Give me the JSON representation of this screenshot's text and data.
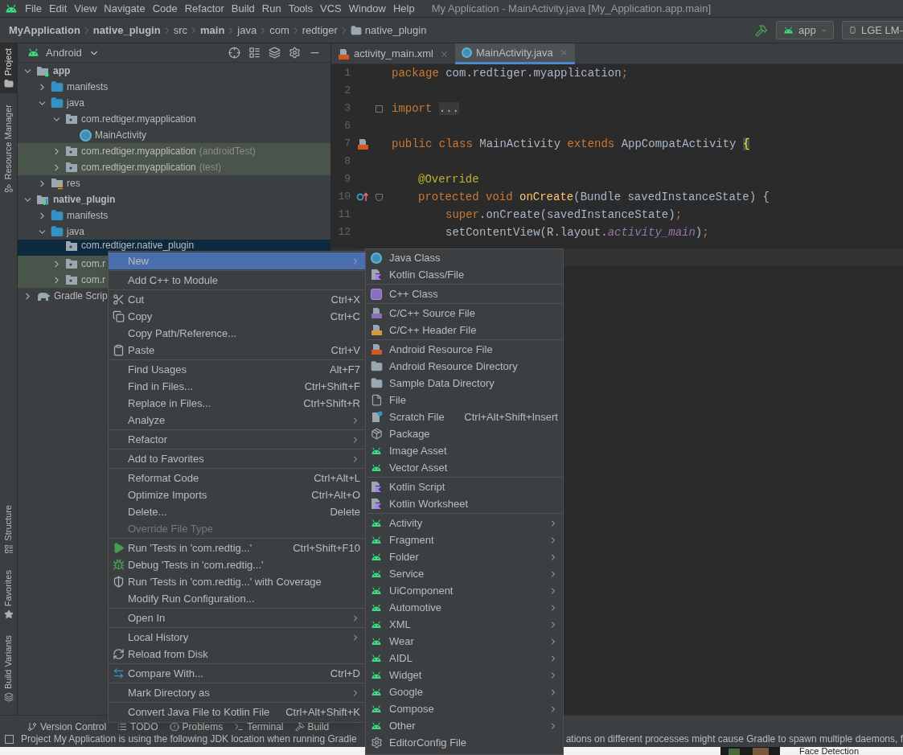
{
  "menu_bar": {
    "items": [
      "File",
      "Edit",
      "View",
      "Navigate",
      "Code",
      "Refactor",
      "Build",
      "Run",
      "Tools",
      "VCS",
      "Window",
      "Help"
    ],
    "title": "My Application - MainActivity.java [My_Application.app.main]"
  },
  "breadcrumbs": [
    {
      "label": "MyApplication",
      "bold": true,
      "folder": false
    },
    {
      "label": "native_plugin",
      "bold": true,
      "folder": false
    },
    {
      "label": "src",
      "bold": false,
      "folder": false
    },
    {
      "label": "main",
      "bold": true,
      "folder": false
    },
    {
      "label": "java",
      "bold": false,
      "folder": false
    },
    {
      "label": "com",
      "bold": false,
      "folder": false
    },
    {
      "label": "redtiger",
      "bold": false,
      "folder": false
    },
    {
      "label": "native_plugin",
      "bold": false,
      "folder": true
    }
  ],
  "run_config": {
    "label": "app"
  },
  "device": {
    "label": "LGE LM-"
  },
  "tool_strip": {
    "top": [
      {
        "label": "Project",
        "selected": true,
        "kind": "folder"
      },
      {
        "label": "Resource Manager",
        "selected": false,
        "kind": "shapes"
      }
    ],
    "bottom": [
      {
        "label": "Structure",
        "kind": "structure"
      },
      {
        "label": "Favorites",
        "kind": "star"
      },
      {
        "label": "Build Variants",
        "kind": "variants"
      }
    ]
  },
  "project_panel": {
    "view": "Android",
    "tree": [
      {
        "label": "app",
        "kind": "module",
        "expanded": true,
        "selected": false,
        "children": [
          {
            "label": "manifests",
            "kind": "folder",
            "expanded": false,
            "selected": false
          },
          {
            "label": "java",
            "kind": "folder",
            "expanded": true,
            "selected": false,
            "children": [
              {
                "label": "com.redtiger.myapplication",
                "kind": "package",
                "expanded": true,
                "selected": false,
                "children": [
                  {
                    "label": "MainActivity",
                    "kind": "class",
                    "selected": false
                  }
                ]
              },
              {
                "label": "com.redtiger.myapplication",
                "suffix": "(androidTest)",
                "kind": "test_package",
                "expanded": false,
                "selected": false
              },
              {
                "label": "com.redtiger.myapplication",
                "suffix": "(test)",
                "kind": "test_package",
                "expanded": false,
                "selected": false
              }
            ]
          },
          {
            "label": "res",
            "kind": "res",
            "expanded": false,
            "selected": false
          }
        ]
      },
      {
        "label": "native_plugin",
        "kind": "native_module",
        "expanded": true,
        "selected": false,
        "children": [
          {
            "label": "manifests",
            "kind": "folder",
            "expanded": false,
            "selected": false
          },
          {
            "label": "java",
            "kind": "folder",
            "expanded": true,
            "selected": false,
            "children": [
              {
                "label": "com.redtiger.native_plugin",
                "kind": "package",
                "selected": true
              },
              {
                "label": "com.r",
                "kind": "test_package",
                "expanded": false,
                "selected": false
              },
              {
                "label": "com.r",
                "kind": "test_package",
                "expanded": false,
                "selected": false
              }
            ]
          }
        ]
      },
      {
        "label": "Gradle Scrip",
        "kind": "gradle",
        "expanded": false,
        "selected": false
      }
    ]
  },
  "editor": {
    "tabs": [
      {
        "label": "activity_main.xml",
        "kind": "xml",
        "selected": false
      },
      {
        "label": "MainActivity.java",
        "kind": "java",
        "selected": true
      }
    ],
    "lines": [
      {
        "number": "1",
        "kind": "top",
        "tokens": [
          {
            "text": "package",
            "kind": "keyword"
          },
          {
            "text": " com.redtiger.myapplication",
            "kind": "plain"
          },
          {
            "text": ";",
            "kind": "keyword"
          }
        ]
      },
      {
        "number": "2",
        "kind": "top"
      },
      {
        "number": "3",
        "kind": "import",
        "tokens": [
          {
            "text": "import",
            "kind": "keyword"
          },
          {
            "text": "...",
            "kind": "folded"
          }
        ]
      },
      {
        "number": "6",
        "kind": "top"
      },
      {
        "number": "7",
        "kind": "class",
        "tokens": [
          {
            "text": "public class",
            "kind": "keyword"
          },
          {
            "text": " MainActivity ",
            "kind": "plain"
          },
          {
            "text": "extends",
            "kind": "keyword"
          },
          {
            "text": " AppCompatActivity ",
            "kind": "plain"
          },
          {
            "text": "{",
            "kind": "brace"
          }
        ]
      },
      {
        "number": "8",
        "kind": "top"
      },
      {
        "number": "9",
        "kind": "annotation",
        "tokens": [
          {
            "text": "@Override",
            "kind": "annotation"
          }
        ]
      },
      {
        "number": "10",
        "kind": "method",
        "tokens": [
          {
            "text": "protected void",
            "kind": "keyword"
          },
          {
            "text": "onCreate",
            "kind": "method"
          },
          {
            "text": "(Bundle savedInstanceState) {",
            "kind": "plain"
          }
        ]
      },
      {
        "number": "11",
        "kind": "statement",
        "tokens": [
          {
            "text": "super",
            "kind": "keyword"
          },
          {
            "text": ".onCreate(savedInstanceState)",
            "kind": "plain"
          },
          {
            "text": ";",
            "kind": "keyword"
          }
        ]
      },
      {
        "number": "12",
        "kind": "statement",
        "tokens": [
          {
            "text": "setContentView(R.layout.",
            "kind": "plain"
          },
          {
            "text": "activity_main",
            "kind": "field"
          },
          {
            "text": ")",
            "kind": "plain"
          },
          {
            "text": ";",
            "kind": "keyword"
          }
        ]
      }
    ]
  },
  "context_menu": {
    "items": [
      {
        "kind": "plain",
        "label": "New",
        "submenu": true,
        "highlighted": true,
        "disabled": false
      },
      {
        "kind": "separator"
      },
      {
        "kind": "plain",
        "label": "Add C++ to Module",
        "submenu": false,
        "highlighted": false,
        "disabled": false
      },
      {
        "kind": "separator"
      },
      {
        "kind": "cut",
        "label": "Cut",
        "shortcut": "Ctrl+X",
        "submenu": false,
        "highlighted": false,
        "disabled": false
      },
      {
        "kind": "copy",
        "label": "Copy",
        "shortcut": "Ctrl+C",
        "submenu": false,
        "highlighted": false,
        "disabled": false
      },
      {
        "kind": "plain",
        "label": "Copy Path/Reference...",
        "submenu": false,
        "highlighted": false,
        "disabled": false
      },
      {
        "kind": "paste",
        "label": "Paste",
        "shortcut": "Ctrl+V",
        "submenu": false,
        "highlighted": false,
        "disabled": false
      },
      {
        "kind": "separator"
      },
      {
        "kind": "plain",
        "label": "Find Usages",
        "shortcut": "Alt+F7",
        "submenu": false,
        "highlighted": false,
        "disabled": false
      },
      {
        "kind": "plain",
        "label": "Find in Files...",
        "shortcut": "Ctrl+Shift+F",
        "submenu": false,
        "highlighted": false,
        "disabled": false
      },
      {
        "kind": "plain",
        "label": "Replace in Files...",
        "shortcut": "Ctrl+Shift+R",
        "submenu": false,
        "highlighted": false,
        "disabled": false
      },
      {
        "kind": "plain",
        "label": "Analyze",
        "submenu": true,
        "highlighted": false,
        "disabled": false
      },
      {
        "kind": "separator"
      },
      {
        "kind": "plain",
        "label": "Refactor",
        "submenu": true,
        "highlighted": false,
        "disabled": false
      },
      {
        "kind": "separator"
      },
      {
        "kind": "plain",
        "label": "Add to Favorites",
        "submenu": true,
        "highlighted": false,
        "disabled": false
      },
      {
        "kind": "separator"
      },
      {
        "kind": "plain",
        "label": "Reformat Code",
        "shortcut": "Ctrl+Alt+L",
        "submenu": false,
        "highlighted": false,
        "disabled": false
      },
      {
        "kind": "plain",
        "label": "Optimize Imports",
        "shortcut": "Ctrl+Alt+O",
        "submenu": false,
        "highlighted": false,
        "disabled": false
      },
      {
        "kind": "plain",
        "label": "Delete...",
        "shortcut": "Delete",
        "submenu": false,
        "highlighted": false,
        "disabled": false
      },
      {
        "kind": "plain",
        "label": "Override File Type",
        "submenu": false,
        "highlighted": false,
        "disabled": true
      },
      {
        "kind": "separator"
      },
      {
        "kind": "run",
        "label": "Run 'Tests in 'com.redtig...'",
        "shortcut": "Ctrl+Shift+F10",
        "submenu": false,
        "highlighted": false,
        "disabled": false
      },
      {
        "kind": "debug",
        "label": "Debug 'Tests in 'com.redtig...'",
        "submenu": false,
        "highlighted": false,
        "disabled": false
      },
      {
        "kind": "coverage",
        "label": "Run 'Tests in 'com.redtig...' with Coverage",
        "submenu": false,
        "highlighted": false,
        "disabled": false
      },
      {
        "kind": "plain",
        "label": "Modify Run Configuration...",
        "submenu": false,
        "highlighted": false,
        "disabled": false
      },
      {
        "kind": "separator"
      },
      {
        "kind": "plain",
        "label": "Open In",
        "submenu": true,
        "highlighted": false,
        "disabled": false
      },
      {
        "kind": "separator"
      },
      {
        "kind": "plain",
        "label": "Local History",
        "submenu": true,
        "highlighted": false,
        "disabled": false
      },
      {
        "kind": "reload",
        "label": "Reload from Disk",
        "submenu": false,
        "highlighted": false,
        "disabled": false
      },
      {
        "kind": "separator"
      },
      {
        "kind": "compare",
        "label": "Compare With...",
        "shortcut": "Ctrl+D",
        "submenu": false,
        "highlighted": false,
        "disabled": false
      },
      {
        "kind": "separator"
      },
      {
        "kind": "plain",
        "label": "Mark Directory as",
        "submenu": true,
        "highlighted": false,
        "disabled": false
      },
      {
        "kind": "separator"
      },
      {
        "kind": "plain",
        "label": "Convert Java File to Kotlin File",
        "shortcut": "Ctrl+Alt+Shift+K",
        "submenu": false,
        "highlighted": false,
        "disabled": false
      }
    ]
  },
  "new_submenu": {
    "items": [
      {
        "kind": "java_class",
        "label": "Java Class",
        "submenu": false
      },
      {
        "kind": "kotlin_file",
        "label": "Kotlin Class/File",
        "submenu": false
      },
      {
        "kind": "separator"
      },
      {
        "kind": "cpp_class",
        "label": "C++ Class",
        "submenu": false
      },
      {
        "kind": "separator"
      },
      {
        "kind": "cpp_source",
        "label": "C/C++ Source File",
        "submenu": false
      },
      {
        "kind": "cpp_header",
        "label": "C/C++ Header File",
        "submenu": false
      },
      {
        "kind": "separator"
      },
      {
        "kind": "resource_file",
        "label": "Android Resource File",
        "submenu": false
      },
      {
        "kind": "folder",
        "label": "Android Resource Directory",
        "submenu": false
      },
      {
        "kind": "folder",
        "label": "Sample Data Directory",
        "submenu": false
      },
      {
        "kind": "file",
        "label": "File",
        "submenu": false
      },
      {
        "kind": "scratch",
        "label": "Scratch File",
        "shortcut": "Ctrl+Alt+Shift+Insert",
        "submenu": false
      },
      {
        "kind": "package",
        "label": "Package",
        "submenu": false
      },
      {
        "kind": "android",
        "label": "Image Asset",
        "submenu": false
      },
      {
        "kind": "android",
        "label": "Vector Asset",
        "submenu": false
      },
      {
        "kind": "separator"
      },
      {
        "kind": "kotlin_file",
        "label": "Kotlin Script",
        "submenu": false
      },
      {
        "kind": "kotlin_file",
        "label": "Kotlin Worksheet",
        "submenu": false
      },
      {
        "kind": "separator"
      },
      {
        "kind": "android",
        "label": "Activity",
        "submenu": true
      },
      {
        "kind": "android",
        "label": "Fragment",
        "submenu": true
      },
      {
        "kind": "android",
        "label": "Folder",
        "submenu": true
      },
      {
        "kind": "android",
        "label": "Service",
        "submenu": true
      },
      {
        "kind": "android",
        "label": "UiComponent",
        "submenu": true
      },
      {
        "kind": "android",
        "label": "Automotive",
        "submenu": true
      },
      {
        "kind": "android",
        "label": "XML",
        "submenu": true
      },
      {
        "kind": "android",
        "label": "Wear",
        "submenu": true
      },
      {
        "kind": "android",
        "label": "AIDL",
        "submenu": true
      },
      {
        "kind": "android",
        "label": "Widget",
        "submenu": true
      },
      {
        "kind": "android",
        "label": "Google",
        "submenu": true
      },
      {
        "kind": "android",
        "label": "Compose",
        "submenu": true
      },
      {
        "kind": "android",
        "label": "Other",
        "submenu": true
      },
      {
        "kind": "gear",
        "label": "EditorConfig File",
        "submenu": false
      }
    ]
  },
  "tool_tabs": [
    {
      "label": "Version Control",
      "kind": "branch"
    },
    {
      "label": "TODO",
      "kind": "list"
    },
    {
      "label": "Problems",
      "kind": "alert"
    },
    {
      "label": "Terminal",
      "kind": "terminal"
    },
    {
      "label": "Build",
      "kind": "hammer"
    }
  ],
  "status_bar": {
    "message_start": "Project My Application is using the following JDK location when running Gradle",
    "message_end": "ations on different processes might cause Gradle to spawn multiple daemons, f"
  },
  "background_window": {
    "label": "Face Detection"
  }
}
